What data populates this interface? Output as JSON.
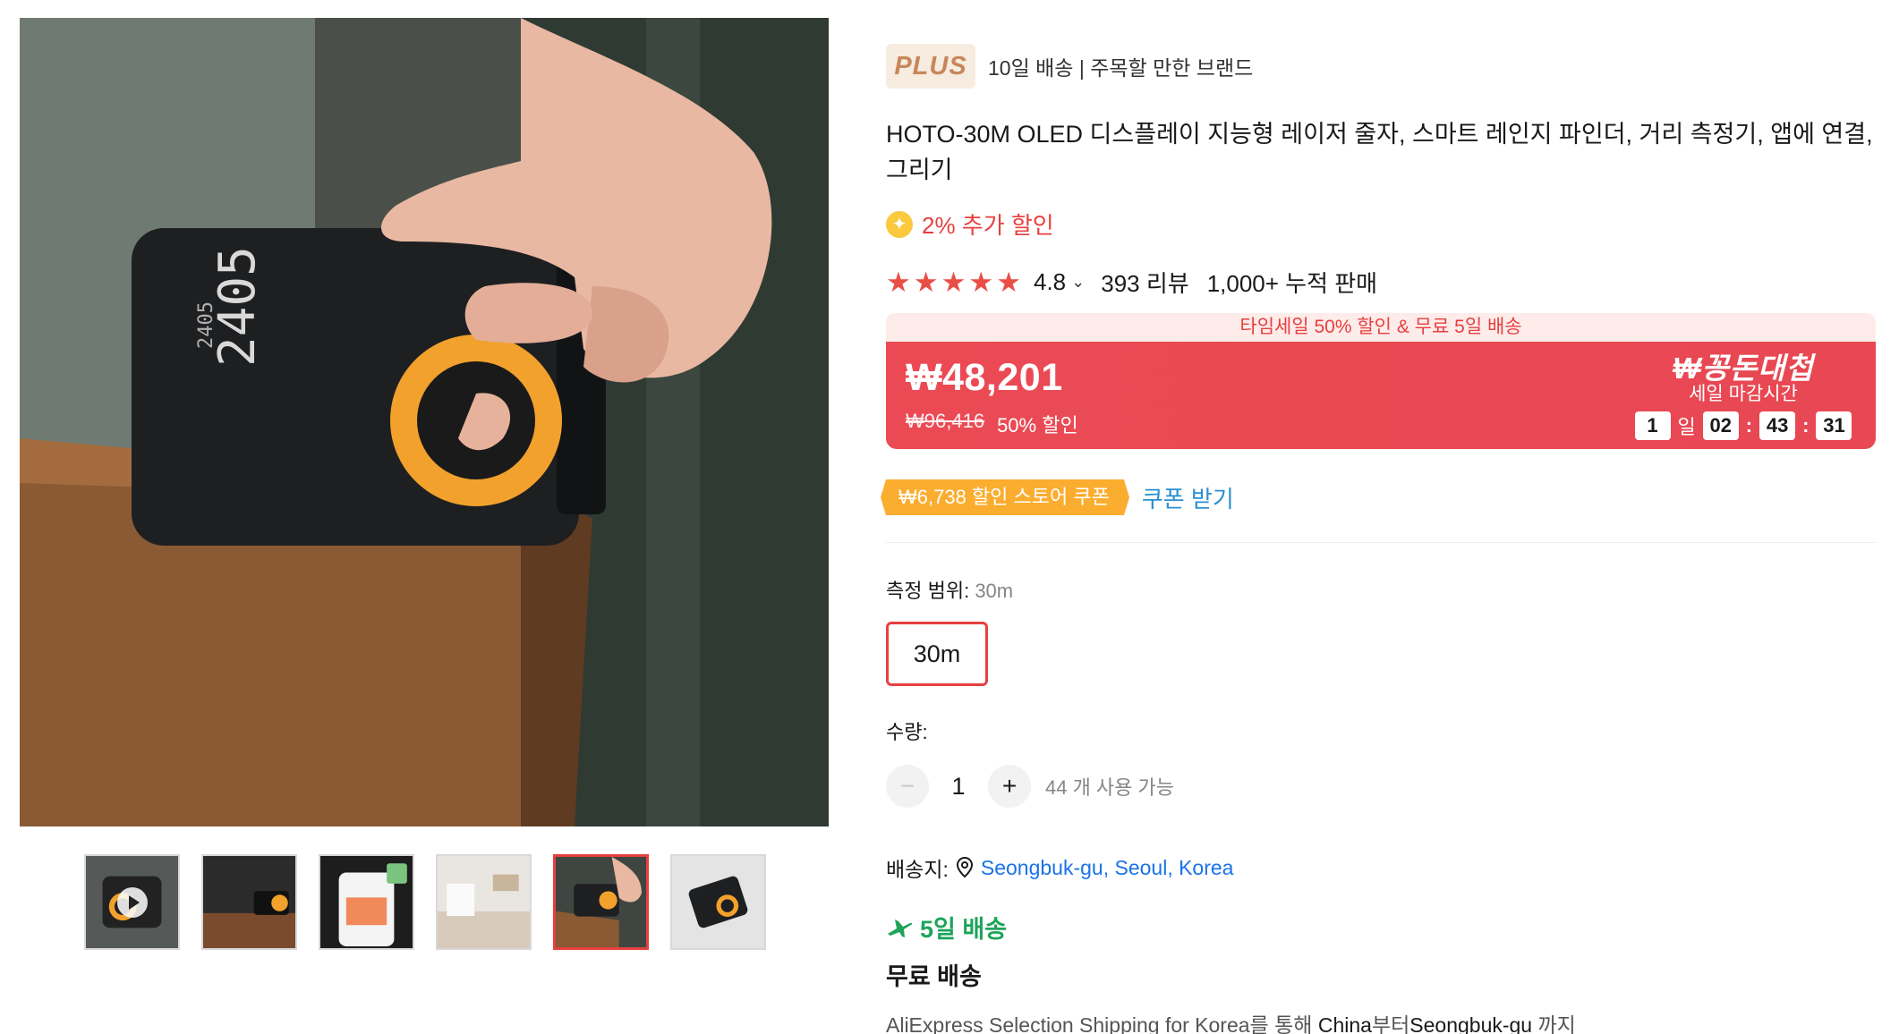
{
  "gallery": {
    "thumbnails": [
      {
        "kind": "video",
        "active": false
      },
      {
        "kind": "image",
        "active": false
      },
      {
        "kind": "image",
        "active": false
      },
      {
        "kind": "image",
        "active": false
      },
      {
        "kind": "image",
        "active": true
      },
      {
        "kind": "image",
        "active": false
      }
    ]
  },
  "product": {
    "brand_logo": "PLUS",
    "brand_tags": "10일 배송 | 주목할 만한 브랜드",
    "title": "HOTO-30M OLED 디스플레이 지능형 레이저 줄자, 스마트 레인지 파인더, 거리 측정기, 앱에 연결, 그리기",
    "extra_discount": "2% 추가 할인",
    "rating": "4.8",
    "rating_chevron": "⌄",
    "stars": 5,
    "reviews": "393 리뷰",
    "sold": "1,000+ 누적 판매"
  },
  "sale": {
    "banner": "타임세일 50% 할인 & 무료 5일 배송",
    "price": "₩48,201",
    "old_price": "₩96,416",
    "discount": "50% 할인",
    "campaign": "₩꽁돈대첩",
    "countdown_label": "세일 마감시간",
    "countdown": {
      "days": "1",
      "day_unit": "일",
      "hours": "02",
      "minutes": "43",
      "seconds": "31",
      "sep": ":"
    }
  },
  "coupon": {
    "tag": "₩6,738 할인 스토어 쿠폰",
    "action": "쿠폰 받기"
  },
  "options": {
    "range_label": "측정 범위:",
    "range_value": "30m",
    "range_option": "30m"
  },
  "quantity": {
    "label": "수량:",
    "minus": "−",
    "value": "1",
    "plus": "+",
    "available": "44 개 사용 가능"
  },
  "shipping": {
    "to_label": "배송지:",
    "location": "Seongbuk-gu, Seoul, Korea",
    "fast": "5일 배송",
    "free": "무료 배송",
    "detail_prefix": "AliExpress Selection Shipping for Korea를 통해 ",
    "from": "China",
    "detail_mid": "부터",
    "to": "Seongbuk-gu",
    "detail_suffix": " 까지"
  },
  "colors": {
    "accent_red": "#e83f3f",
    "coupon_orange": "#fbad2f",
    "link_blue": "#1a73e8",
    "ship_green": "#1ea45a",
    "star_red": "#ea4e45"
  },
  "icons": [
    "play-icon",
    "sparkle-icon",
    "star-icon",
    "chevron-down-icon",
    "location-pin-icon",
    "plane-icon",
    "minus-icon",
    "plus-icon"
  ]
}
